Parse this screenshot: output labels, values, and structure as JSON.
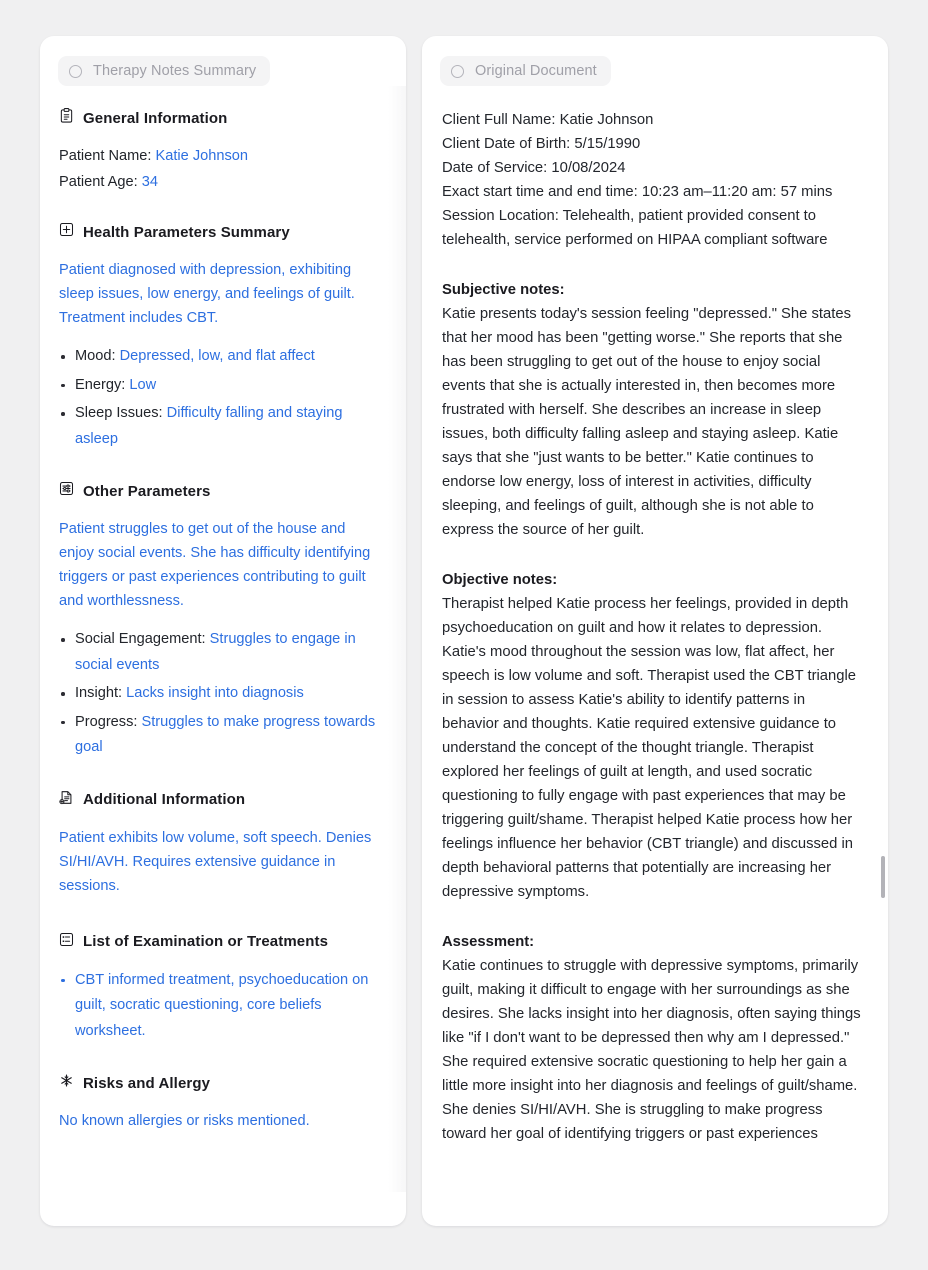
{
  "left_panel": {
    "header": {
      "icon": "circle-icon",
      "label": "Therapy Notes Summary"
    },
    "sections": {
      "general": {
        "icon": "clipboard-icon",
        "title": "General Information",
        "patient_name_label": "Patient Name: ",
        "patient_name_value": "Katie Johnson",
        "patient_age_label": "Patient Age: ",
        "patient_age_value": "34"
      },
      "health": {
        "icon": "square-plus-icon",
        "title": "Health Parameters Summary",
        "summary": "Patient diagnosed with depression, exhibiting sleep issues, low energy, and feelings of guilt. Treatment includes CBT.",
        "items": [
          {
            "label": "Mood: ",
            "value": "Depressed, low, and flat affect"
          },
          {
            "label": "Energy: ",
            "value": "Low"
          },
          {
            "label": "Sleep Issues: ",
            "value": "Difficulty falling and staying asleep"
          }
        ]
      },
      "other": {
        "icon": "sliders-square-icon",
        "title": "Other Parameters",
        "summary": "Patient struggles to get out of the house and enjoy social events. She has difficulty identifying triggers or past experiences contributing to guilt and worthlessness.",
        "items": [
          {
            "label": "Social Engagement: ",
            "value": "Struggles to engage in social events"
          },
          {
            "label": "Insight: ",
            "value": "Lacks insight into diagnosis"
          },
          {
            "label": "Progress: ",
            "value": "Struggles to make progress towards goal"
          }
        ]
      },
      "additional": {
        "icon": "document-add-icon",
        "title": "Additional Information",
        "summary": "Patient exhibits low volume, soft speech. Denies SI/HI/AVH. Requires extensive guidance in sessions."
      },
      "examination": {
        "icon": "list-square-icon",
        "title": "List of Examination or Treatments",
        "items": [
          "CBT informed treatment, psychoeducation on guilt, socratic questioning, core beliefs worksheet."
        ]
      },
      "risks": {
        "icon": "asterisk-icon",
        "title": "Risks and Allergy",
        "summary": "No known allergies or risks mentioned."
      }
    }
  },
  "right_panel": {
    "header": {
      "icon": "circle-icon",
      "label": "Original Document"
    },
    "meta_lines": [
      "Client Full Name: Katie Johnson",
      "Client Date of Birth: 5/15/1990",
      "Date of Service: 10/08/2024",
      "Exact start time and end time: 10:23 am–11:20 am: 57 mins",
      "Session Location: Telehealth, patient provided consent to telehealth, service performed on HIPAA compliant software"
    ],
    "blocks": [
      {
        "heading": "Subjective notes:",
        "body": "Katie presents today's session feeling \"depressed.\" She states that her mood has been \"getting worse.\" She reports that she has been struggling to get out of the house to enjoy social events that she is actually interested in, then becomes more frustrated with herself. She describes an increase in sleep issues, both difficulty falling asleep and staying asleep. Katie says that she \"just wants to be better.\" Katie continues to endorse low energy, loss of interest in activities, difficulty sleeping, and feelings of guilt, although she is not able to express the source of her guilt."
      },
      {
        "heading": "Objective notes:",
        "body": "Therapist helped Katie process her feelings, provided in depth psychoeducation on guilt and how it relates to depression. Katie's mood throughout the session was low, flat affect, her speech is low volume and soft. Therapist used the CBT triangle in session to assess Katie's ability to identify patterns in behavior and thoughts. Katie required extensive guidance to understand the concept of the thought triangle. Therapist explored her feelings of guilt at length, and used socratic questioning to fully engage with past experiences that may be triggering guilt/shame. Therapist helped Katie process how her feelings influence her behavior (CBT triangle) and discussed in depth behavioral patterns that potentially are increasing her depressive symptoms."
      },
      {
        "heading": "Assessment:",
        "body": "Katie continues to struggle with depressive symptoms, primarily guilt, making it difficult to engage with her surroundings as she desires. She lacks insight into her diagnosis, often saying things like \"if I don't want to be depressed then why am I depressed.\" She required extensive socratic questioning to help her gain a little more insight into her diagnosis and feelings of guilt/shame. She denies SI/HI/AVH. She is struggling to make progress toward her goal of identifying triggers or past experiences"
      }
    ]
  },
  "colors": {
    "background": "#f0f0f1",
    "panel": "#ffffff",
    "accent_blue": "#2d6fe0",
    "text": "#23262c",
    "muted": "#a0a0a8"
  }
}
